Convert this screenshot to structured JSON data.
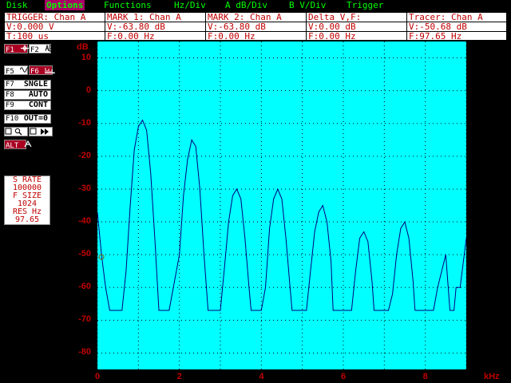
{
  "menu": [
    {
      "label": "Disk",
      "active": false
    },
    {
      "label": "Options",
      "active": true
    },
    {
      "label": "Functions",
      "active": false
    },
    {
      "label": "Hz/Div",
      "active": false
    },
    {
      "label": "A dB/Div",
      "active": false
    },
    {
      "label": "B V/Div",
      "active": false
    },
    {
      "label": "Trigger",
      "active": false
    }
  ],
  "info": {
    "trigger": {
      "l1": "TRIGGER: Chan A",
      "l2": "V:0.000 V",
      "l3": "T:100 us"
    },
    "mark1": {
      "l1": "MARK  1: Chan A",
      "l2": "V:-63.80 dB",
      "l3": "F:0.00 Hz"
    },
    "mark2": {
      "l1": "MARK  2: Chan A",
      "l2": "V:-63.80 dB",
      "l3": "F:0.00 Hz"
    },
    "delta": {
      "l1": "Delta V,F:",
      "l2": "V:0.00 dB",
      "l3": "F:0.00 Hz"
    },
    "tracer": {
      "l1": "Tracer: Chan A",
      "l2": "V:-50.68 dB",
      "l3": "F:97.65 Hz"
    }
  },
  "fkeys": {
    "f1": "F1",
    "f2": "F2",
    "f5": "F5",
    "f6": "F6",
    "f7": "F7",
    "f7_label": "SNGLE",
    "f8": "F8",
    "f8_label": "AUTO",
    "f9": "F9",
    "f9_label": "CONT",
    "f10": "F10",
    "f10_label": "OUT=0",
    "alt": "ALT"
  },
  "stats": {
    "srate_label": "S RATE",
    "srate_value": "100000",
    "fsize_label": "F SIZE",
    "fsize_value": "1024",
    "res_label": "RES Hz",
    "res_value": "97.65"
  },
  "colors": {
    "plot_bg": "#00ffff",
    "trace": "#000080",
    "grid": "#000000",
    "axis_label": "#c00000",
    "info_text": "#c00000",
    "menu_text": "#00ff00",
    "menu_active_bg": "#aa0066"
  },
  "chart_data": {
    "type": "line",
    "ylabel": "dB",
    "xlabel": "kHz",
    "xlim": [
      0,
      9
    ],
    "ylim": [
      -85,
      15
    ],
    "y_ticks": [
      10,
      0,
      -10,
      -20,
      -30,
      -40,
      -50,
      -60,
      -70,
      -80
    ],
    "x_ticks": [
      0,
      2,
      4,
      6,
      8
    ],
    "grid": true,
    "tracer": {
      "x": 0.098,
      "y": -50.68
    },
    "series": [
      {
        "x": [
          0,
          0.1,
          0.2,
          0.3,
          0.35,
          0.6,
          0.7,
          0.8,
          0.9,
          1.0,
          1.1,
          1.2,
          1.3,
          1.4,
          1.5,
          1.6,
          1.7,
          1.75,
          2.0,
          2.1,
          2.2,
          2.3,
          2.4,
          2.5,
          2.6,
          2.7,
          2.75,
          3.0,
          3.1,
          3.2,
          3.3,
          3.4,
          3.5,
          3.6,
          3.7,
          3.75,
          4.0,
          4.1,
          4.2,
          4.3,
          4.4,
          4.5,
          4.6,
          4.7,
          4.75,
          5.0,
          5.1,
          5.2,
          5.3,
          5.4,
          5.5,
          5.6,
          5.7,
          5.75,
          6.0,
          6.1,
          6.2,
          6.3,
          6.4,
          6.5,
          6.6,
          6.7,
          6.75,
          7.0,
          7.1,
          7.2,
          7.3,
          7.4,
          7.5,
          7.6,
          7.7,
          7.75,
          8.0,
          8.1,
          8.2,
          8.3,
          8.4,
          8.5,
          8.6,
          8.7,
          8.75,
          8.85,
          9.0
        ],
        "y": [
          -37,
          -50,
          -60,
          -67,
          -67,
          -67,
          -55,
          -35,
          -18,
          -11,
          -9,
          -12,
          -25,
          -45,
          -67,
          -67,
          -67,
          -67,
          -50,
          -32,
          -21,
          -15,
          -17,
          -30,
          -50,
          -67,
          -67,
          -67,
          -54,
          -40,
          -32,
          -30,
          -33,
          -45,
          -60,
          -67,
          -67,
          -60,
          -42,
          -33,
          -30,
          -33,
          -45,
          -60,
          -67,
          -67,
          -67,
          -55,
          -43,
          -37,
          -35,
          -40,
          -52,
          -67,
          -67,
          -67,
          -67,
          -55,
          -45,
          -43,
          -46,
          -58,
          -67,
          -67,
          -67,
          -62,
          -50,
          -42,
          -40,
          -45,
          -58,
          -67,
          -67,
          -67,
          -67,
          -60,
          -55,
          -50,
          -67,
          -67,
          -60,
          -60,
          -45
        ]
      }
    ]
  }
}
